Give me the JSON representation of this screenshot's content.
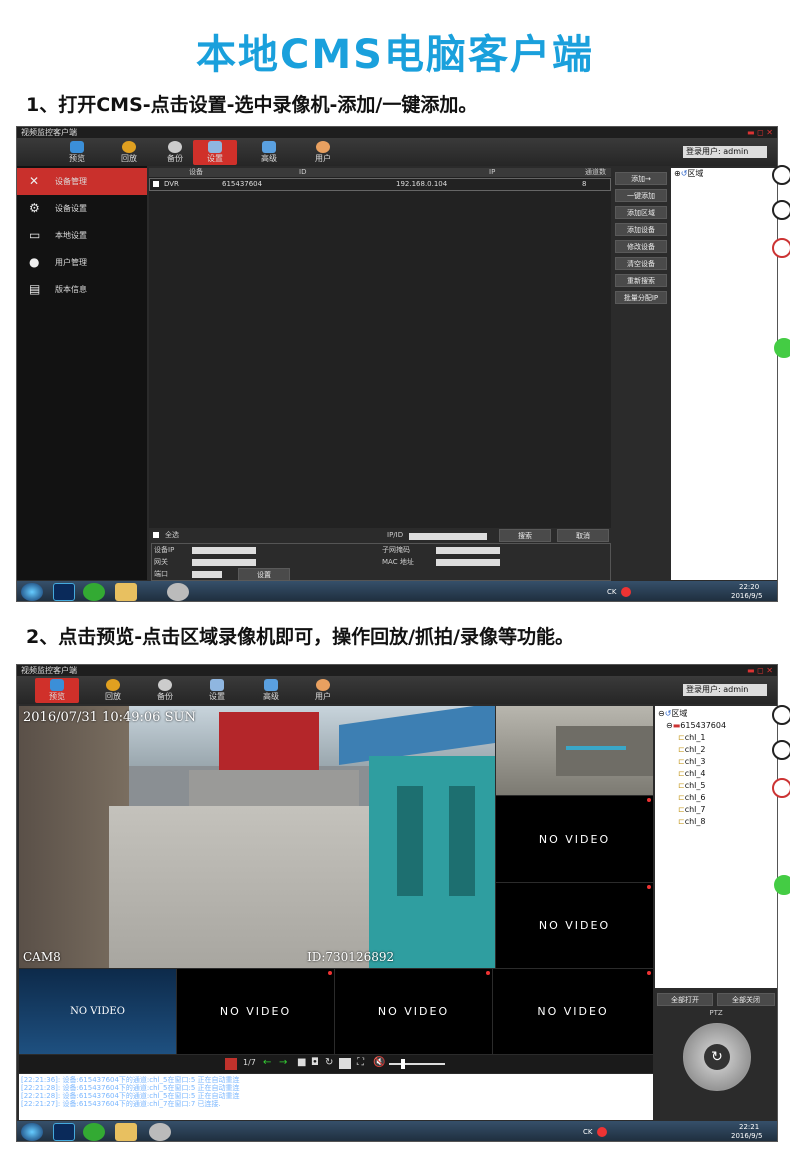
{
  "title": "本地CMS电脑客户端",
  "step1": "1、打开CMS-点击设置-选中录像机-添加/一键添加。",
  "step2": "2、点击预览-点击区域录像机即可，操作回放/抓拍/录像等功能。",
  "app": {
    "window_title": "视频监控客户端",
    "login_label": "登录用户: admin",
    "toolbar": [
      "预览",
      "回放",
      "备份",
      "设置",
      "高级",
      "用户"
    ],
    "colors": {
      "active": "#d0302a",
      "accent": "#1aa0dc"
    }
  },
  "shot1": {
    "sidebar": [
      {
        "label": "设备管理",
        "icon": "wrench-icon"
      },
      {
        "label": "设备设置",
        "icon": "gears-icon"
      },
      {
        "label": "本地设置",
        "icon": "monitor-icon"
      },
      {
        "label": "用户管理",
        "icon": "user-icon"
      },
      {
        "label": "版本信息",
        "icon": "document-icon"
      }
    ],
    "table_headers": [
      "设备",
      "ID",
      "IP",
      "通道数"
    ],
    "row": {
      "device": "DVR",
      "id": "615437604",
      "ip": "192.168.0.104",
      "channels": "8"
    },
    "buttons": [
      "添加→",
      "一键添加",
      "添加区域",
      "添加设备",
      "修改设备",
      "清空设备",
      "重新搜索",
      "批量分配IP"
    ],
    "tree_root": "区域",
    "select_all": "全选",
    "ipid_label": "IP/ID",
    "search_btn": "搜索",
    "cancel_btn": "取消",
    "form": {
      "device_ip": "设备IP",
      "gateway": "网关",
      "port": "端口",
      "subnet": "子网掩码",
      "mac": "MAC 地址",
      "set_btn": "设置"
    },
    "clock_time": "22:20",
    "clock_date": "2016/9/5",
    "tray": "CK"
  },
  "shot2": {
    "osd_time": "2016/07/31 10:49:06 SUN",
    "osd_cam": "CAM8",
    "osd_id": "ID:730126892",
    "no_video": "NO VIDEO",
    "tree_root": "区域",
    "tree_device": "615437604",
    "channels": [
      "chl_1",
      "chl_2",
      "chl_3",
      "chl_4",
      "chl_5",
      "chl_6",
      "chl_7",
      "chl_8"
    ],
    "open_all": "全部打开",
    "close_all": "全部关闭",
    "ptz": "PTZ",
    "page": "1/7",
    "log": [
      "[22:21:36]: 设备:615437604下的通道:chl_5在窗口:5 正在自动重连",
      "[22:21:28]: 设备:615437604下的通道:chl_5在窗口:5 正在自动重连",
      "[22:21:28]: 设备:615437604下的通道:chl_5在窗口:5 正在自动重连",
      "[22:21:27]: 设备:615437604下的通道:chl_7在窗口:7 已连接."
    ],
    "clock_time": "22:21",
    "clock_date": "2016/9/5",
    "tray": "CK"
  }
}
